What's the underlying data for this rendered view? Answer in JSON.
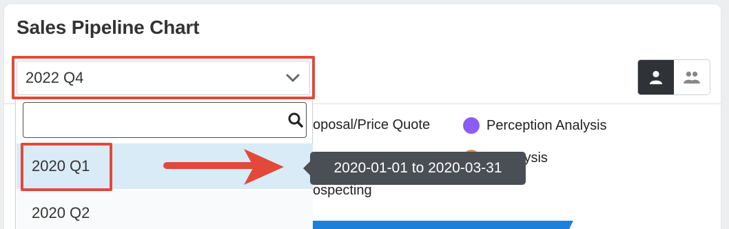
{
  "page": {
    "title": "Sales Pipeline Chart"
  },
  "period_select": {
    "value": "2022 Q4"
  },
  "view_toggle": {
    "user_icon": "user-icon",
    "team_icon": "team-icon"
  },
  "legend": [
    {
      "label": "oposal/Price Quote",
      "color": ""
    },
    {
      "label": "Perception Analysis",
      "color": "#8b5cf6"
    },
    {
      "label": "s Analysis",
      "color": "#f28a3c"
    },
    {
      "label": "ospecting",
      "color": ""
    }
  ],
  "dropdown": {
    "search_value": "",
    "search_icon": "search-icon",
    "options": [
      "2020 Q1",
      "2020 Q2"
    ]
  },
  "tooltip": {
    "text": "2020-01-01 to 2020-03-31"
  },
  "colors": {
    "accent": "#e2493a",
    "selected_option_bg": "#d9ebf7",
    "funnel_bar": "#1e80d8"
  }
}
